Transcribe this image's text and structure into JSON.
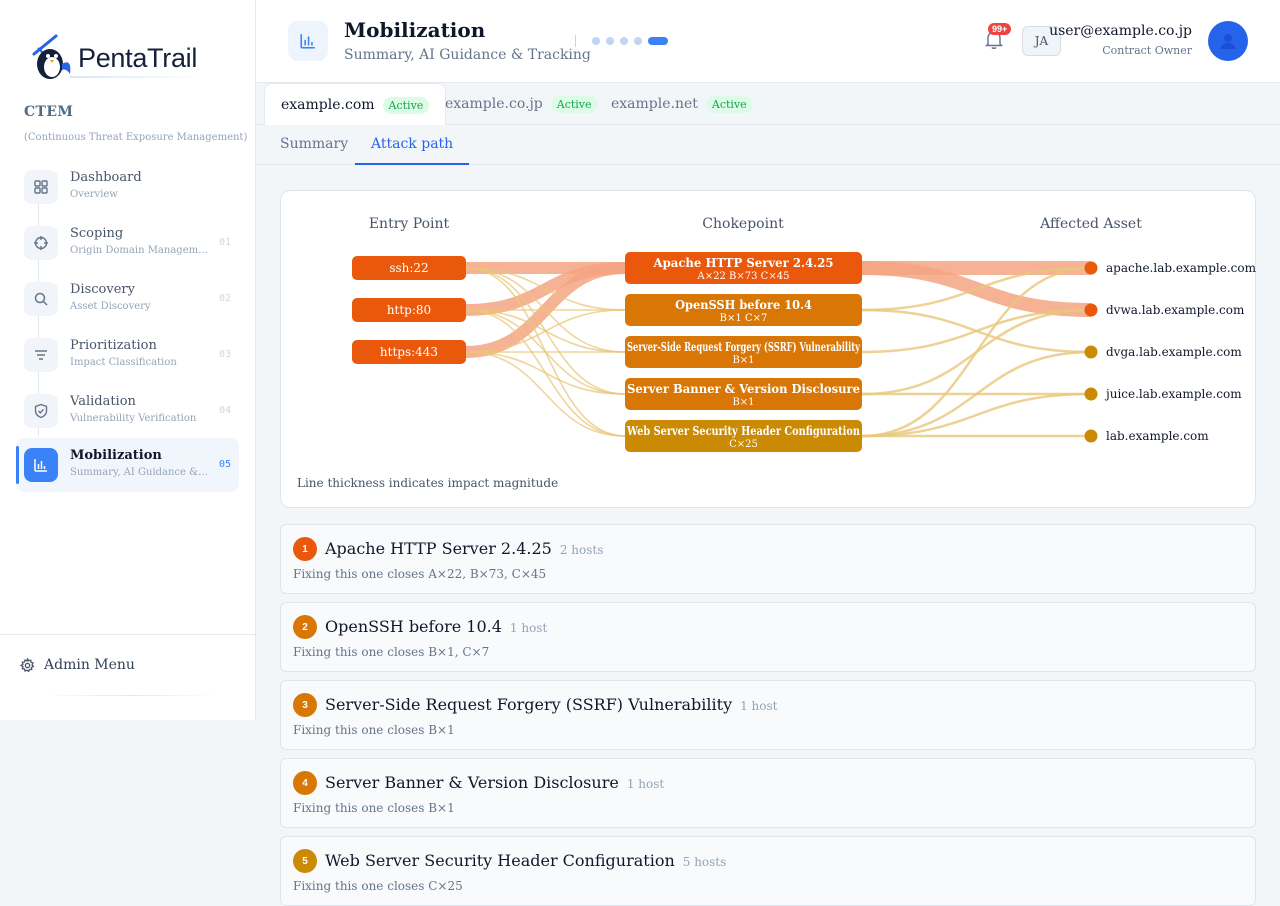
{
  "brand": {
    "name": "PentaTrail"
  },
  "sidebar": {
    "section_title": "CTEM",
    "section_subtitle": "(Continuous Threat Exposure Management)",
    "items": [
      {
        "label": "Dashboard",
        "desc": "Overview",
        "num": "",
        "icon": "grid-icon"
      },
      {
        "label": "Scoping",
        "desc": "Origin Domain Management",
        "num": "01",
        "icon": "target-icon"
      },
      {
        "label": "Discovery",
        "desc": "Asset Discovery",
        "num": "02",
        "icon": "search-icon"
      },
      {
        "label": "Prioritization",
        "desc": "Impact Classification",
        "num": "03",
        "icon": "filter-icon"
      },
      {
        "label": "Validation",
        "desc": "Vulnerability Verification",
        "num": "04",
        "icon": "shield-check-icon"
      },
      {
        "label": "Mobilization",
        "desc": "Summary, AI Guidance & Tracking",
        "num": "05",
        "icon": "bar-chart-icon"
      }
    ],
    "admin_label": "Admin Menu"
  },
  "header": {
    "title": "Mobilization",
    "subtitle": "Summary, AI Guidance & Tracking",
    "notification_count": "99+",
    "initials": "JA",
    "user_email": "user@example.co.jp",
    "user_role": "Contract Owner"
  },
  "domain_tabs": [
    {
      "label": "example.com",
      "status": "Active"
    },
    {
      "label": "example.co.jp",
      "status": "Active"
    },
    {
      "label": "example.net",
      "status": "Active"
    }
  ],
  "view_tabs": [
    {
      "label": "Summary"
    },
    {
      "label": "Attack path"
    }
  ],
  "attack_graph": {
    "columns": {
      "entry": "Entry Point",
      "choke": "Chokepoint",
      "asset": "Affected Asset"
    },
    "note": "Line thickness indicates impact magnitude",
    "entries": [
      "ssh:22",
      "http:80",
      "https:443"
    ],
    "chokepoints": [
      {
        "title": "Apache HTTP Server 2.4.25",
        "detail": "A×22 B×73 C×45",
        "color": "#ea580c"
      },
      {
        "title": "OpenSSH before 10.4",
        "detail": "B×1 C×7",
        "color": "#d97706"
      },
      {
        "title": "Server-Side Request Forgery (SSRF) Vulnerability",
        "detail": "B×1",
        "color": "#d97706"
      },
      {
        "title": "Server Banner & Version Disclosure",
        "detail": "B×1",
        "color": "#d97706"
      },
      {
        "title": "Web Server Security Header Configuration",
        "detail": "C×25",
        "color": "#ca8a04"
      }
    ],
    "assets": [
      {
        "name": "apache.lab.example.com",
        "color": "#ea580c"
      },
      {
        "name": "dvwa.lab.example.com",
        "color": "#ea580c"
      },
      {
        "name": "dvga.lab.example.com",
        "color": "#ca8a04"
      },
      {
        "name": "juice.lab.example.com",
        "color": "#ca8a04"
      },
      {
        "name": "lab.example.com",
        "color": "#ca8a04"
      }
    ],
    "flows_left": [
      {
        "from": 0,
        "to": 0,
        "impact": 3
      },
      {
        "from": 1,
        "to": 0,
        "impact": 3
      },
      {
        "from": 2,
        "to": 0,
        "impact": 3
      },
      {
        "from": 0,
        "to": 1,
        "impact": 1
      },
      {
        "from": 0,
        "to": 2,
        "impact": 1
      },
      {
        "from": 0,
        "to": 3,
        "impact": 1
      },
      {
        "from": 0,
        "to": 4,
        "impact": 1
      },
      {
        "from": 1,
        "to": 1,
        "impact": 1
      },
      {
        "from": 1,
        "to": 2,
        "impact": 1
      },
      {
        "from": 1,
        "to": 3,
        "impact": 1
      },
      {
        "from": 1,
        "to": 4,
        "impact": 1
      },
      {
        "from": 2,
        "to": 1,
        "impact": 1
      },
      {
        "from": 2,
        "to": 2,
        "impact": 1
      },
      {
        "from": 2,
        "to": 3,
        "impact": 1
      },
      {
        "from": 2,
        "to": 4,
        "impact": 1
      }
    ],
    "flows_right": [
      {
        "from": 0,
        "to": 0,
        "impact": 3
      },
      {
        "from": 0,
        "to": 1,
        "impact": 3
      },
      {
        "from": 1,
        "to": 0,
        "impact": 1
      },
      {
        "from": 1,
        "to": 2,
        "impact": 1
      },
      {
        "from": 2,
        "to": 1,
        "impact": 1
      },
      {
        "from": 3,
        "to": 1,
        "impact": 1
      },
      {
        "from": 3,
        "to": 3,
        "impact": 1
      },
      {
        "from": 4,
        "to": 0,
        "impact": 1
      },
      {
        "from": 4,
        "to": 2,
        "impact": 1
      },
      {
        "from": 4,
        "to": 3,
        "impact": 1
      },
      {
        "from": 4,
        "to": 4,
        "impact": 1
      }
    ]
  },
  "fixes": [
    {
      "num": "1",
      "title": "Apache HTTP Server 2.4.25",
      "hosts": "2 hosts",
      "desc": "Fixing this one closes A×22, B×73, C×45",
      "color": "#ea580c"
    },
    {
      "num": "2",
      "title": "OpenSSH before 10.4",
      "hosts": "1 host",
      "desc": "Fixing this one closes B×1, C×7",
      "color": "#d97706"
    },
    {
      "num": "3",
      "title": "Server-Side Request Forgery (SSRF) Vulnerability",
      "hosts": "1 host",
      "desc": "Fixing this one closes B×1",
      "color": "#d97706"
    },
    {
      "num": "4",
      "title": "Server Banner & Version Disclosure",
      "hosts": "1 host",
      "desc": "Fixing this one closes B×1",
      "color": "#d97706"
    },
    {
      "num": "5",
      "title": "Web Server Security Header Configuration",
      "hosts": "5 hosts",
      "desc": "Fixing this one closes C×25",
      "color": "#ca8a04"
    }
  ]
}
